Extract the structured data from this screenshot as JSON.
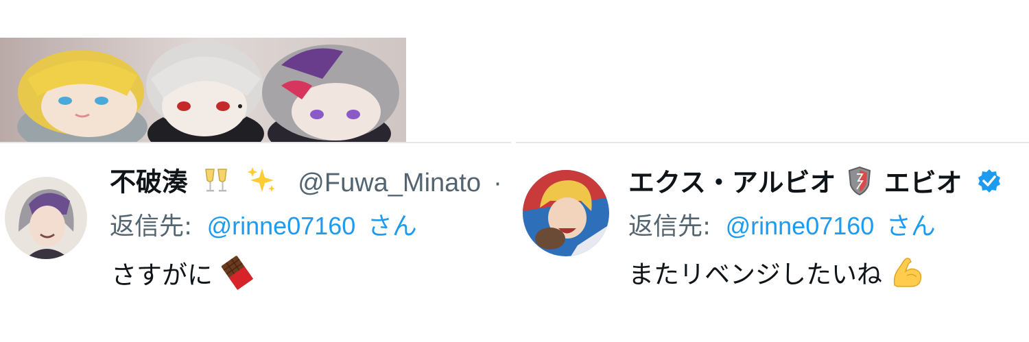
{
  "left_tweet": {
    "media_alt": "plush-dolls-photo",
    "author_name": "不破湊",
    "name_emoji": [
      "champagne-glasses-icon",
      "sparkles-icon"
    ],
    "handle": "@Fuwa_Minato",
    "dot": "·",
    "reply_prefix": "返信先:",
    "reply_mention": "@rinne07160",
    "reply_suffix": "さん",
    "body_text": "さすがに",
    "body_emoji": "chocolate-bar-icon"
  },
  "right_tweet": {
    "author_name_part1": "エクス・アルビオ",
    "name_emoji": "shield-icon",
    "author_name_part2": "エビオ",
    "verified": true,
    "reply_prefix": "返信先:",
    "reply_mention": "@rinne07160",
    "reply_suffix": "さん",
    "body_text": "またリベンジしたいね",
    "body_emoji": "flexed-biceps-icon"
  },
  "colors": {
    "link": "#1d9bf0",
    "secondary_text": "#536471",
    "primary_text": "#0f1419",
    "verified_badge": "#1d9bf0"
  }
}
